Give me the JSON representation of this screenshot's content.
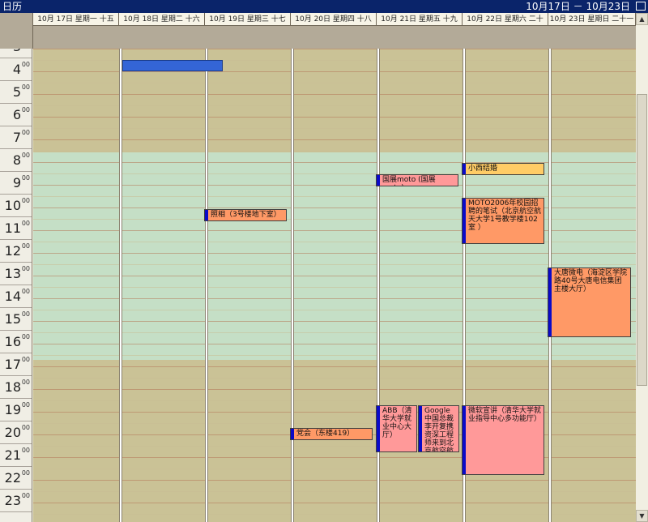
{
  "window": {
    "title": "日历",
    "date_range": "10月17日 － 10月23日"
  },
  "days": [
    "10月 17日 星期一 十五",
    "10月 18日 星期二 十六",
    "10月 19日 星期三 十七",
    "10月 20日 星期四 十八",
    "10月 21日 星期五 十九",
    "10月 22日 星期六 二十",
    "10月 23日 星期日 二十一"
  ],
  "hours": [
    "3",
    "4",
    "5",
    "6",
    "7",
    "8",
    "9",
    "10",
    "11",
    "12",
    "13",
    "14",
    "15",
    "16",
    "17",
    "18",
    "19",
    "20",
    "21",
    "22",
    "23"
  ],
  "minute_label": "00",
  "colors": {
    "offhours": "#cac296",
    "workhours": "#c5dfc6",
    "event_orange": "#ff9966",
    "event_pink": "#ff9999",
    "event_yellow": "#ffcc66",
    "event_blue": "#3465d6",
    "marker": "#0a0ac8"
  },
  "events": {
    "tue_block": "",
    "xiaoxi": "小西结婚",
    "guozhan": "国展moto (国展moto)",
    "moto_exam": "MOTO2006年校园招聘的笔试（北京航空航天大学1号教学楼102室 ）",
    "zhaoxiang": "照相（3号楼地下室）",
    "datang": "大唐微电（海淀区学院路40号大唐电信集团主楼大厅）",
    "abb": "ABB（清华大学就业中心大厅）",
    "google": "Google 中国总裁李开复携资深工程师来到北京航空航天",
    "weiruan": "微软宣讲（清华大学就业指导中心多功能厅）",
    "dang": "党会（东楼419）"
  }
}
